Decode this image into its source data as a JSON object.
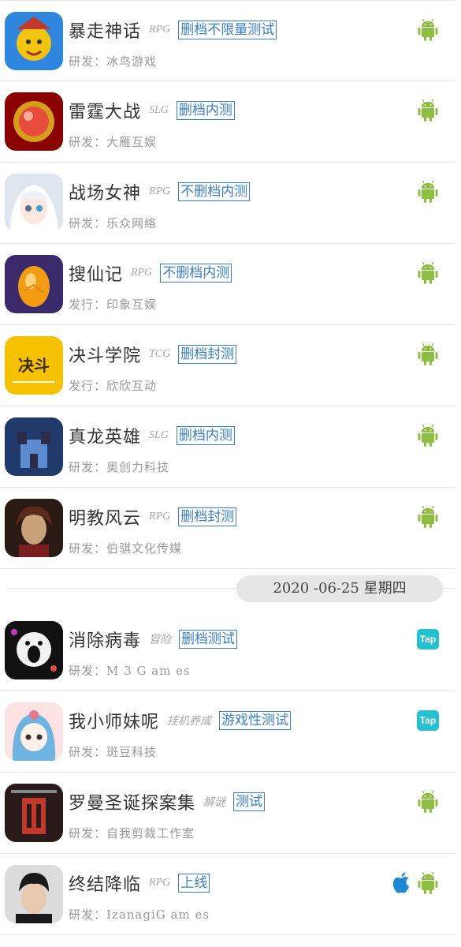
{
  "games": [
    {
      "name": "暴走神话",
      "genre": "RPG",
      "badge": "删档不限量测试",
      "dev": "研发：冰鸟游戏",
      "platforms": [
        "android"
      ],
      "icon": "warrior-icon",
      "colors": [
        "#c0392b",
        "#f1c40f",
        "#2e86de"
      ]
    },
    {
      "name": "雷霆大战",
      "genre": "SLG",
      "badge": "删档内测",
      "dev": "研发：大雁互娱",
      "platforms": [
        "android"
      ],
      "icon": "orb-icon",
      "colors": [
        "#8b0000",
        "#e74c3c",
        "#d4a017"
      ]
    },
    {
      "name": "战场女神",
      "genre": "RPG",
      "badge": "不删档内测",
      "dev": "研发：乐众网络",
      "platforms": [
        "android"
      ],
      "icon": "anime-girl-icon",
      "colors": [
        "#dfe6f0",
        "#5b6b8c",
        "#ffffff"
      ]
    },
    {
      "name": "搜仙记",
      "genre": "RPG",
      "badge": "不删档内测",
      "dev": "发行：印象互娱",
      "platforms": [
        "android"
      ],
      "icon": "egg-icon",
      "colors": [
        "#3a2a6b",
        "#f39c12",
        "#e67e22"
      ]
    },
    {
      "name": "决斗学院",
      "genre": "TCG",
      "badge": "删档封测",
      "dev": "发行：欣欣互动",
      "platforms": [
        "android"
      ],
      "icon": "academy-logo-icon",
      "colors": [
        "#f6c200",
        "#ffffff",
        "#3a2a00"
      ]
    },
    {
      "name": "真龙英雄",
      "genre": "SLG",
      "badge": "删档内测",
      "dev": "研发：奥创力科技",
      "platforms": [
        "android"
      ],
      "icon": "castle-icon",
      "colors": [
        "#1f3a6b",
        "#5b8bd0",
        "#2c2c4a"
      ]
    },
    {
      "name": "明教风云",
      "genre": "RPG",
      "badge": "删档封测",
      "dev": "研发：伯骐文化传媒",
      "platforms": [
        "android"
      ],
      "icon": "lady-portrait-icon",
      "colors": [
        "#5a2a1a",
        "#c9a27a",
        "#2a1a14"
      ]
    }
  ],
  "date_separator": "2020 -06-25 星期四",
  "games2": [
    {
      "name": "消除病毒",
      "genre": "冒险",
      "badge": "删档测试",
      "dev": "研发：M 3 G am es",
      "platforms": [
        "tap"
      ],
      "icon": "virus-face-icon",
      "colors": [
        "#111111",
        "#c039c0",
        "#ffffff"
      ]
    },
    {
      "name": "我小师妹呢",
      "genre": "挂机养成",
      "badge": "游戏性测试",
      "dev": "研发：斑豆科技",
      "platforms": [
        "tap"
      ],
      "icon": "chibi-girl-icon",
      "colors": [
        "#fde3e3",
        "#6fb3e0",
        "#e07a8a"
      ]
    },
    {
      "name": "罗曼圣诞探案集",
      "genre": "解谜",
      "badge": "测试",
      "dev": "研发：自我剪裁工作室",
      "platforms": [
        "android"
      ],
      "icon": "mystery-icon",
      "colors": [
        "#2a1a1a",
        "#c0392b",
        "#888888"
      ]
    },
    {
      "name": "终结降临",
      "genre": "RPG",
      "badge": "上线",
      "dev": "研发：IzanagiG am es",
      "platforms": [
        "apple",
        "android"
      ],
      "icon": "man-portrait-icon",
      "colors": [
        "#dcdcdc",
        "#1a1a1a",
        "#e8c9b0"
      ]
    }
  ],
  "tap_label": "Tap",
  "android_color": "#8cbf3f",
  "apple_color": "#1e88d6"
}
